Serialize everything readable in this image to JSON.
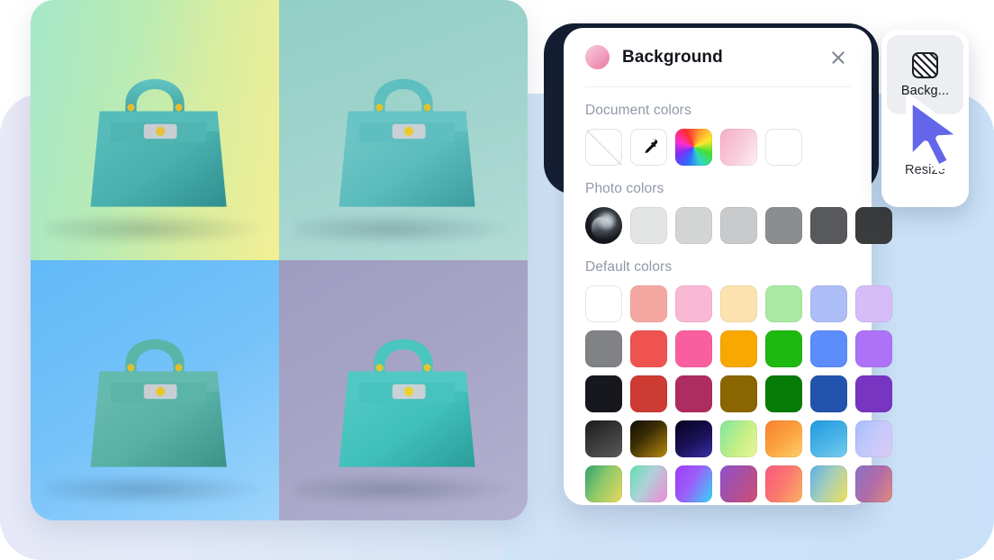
{
  "app": {
    "background_card_colors": [
      "#e8e8f6",
      "#cbe2f8"
    ]
  },
  "photo_grid": {
    "name": "handbag-variants-grid",
    "cells": [
      {
        "id": "q1",
        "background_label": "green to yellow gradient",
        "bg_from": "#a5e8c8",
        "bg_to": "#f2ef94",
        "bag_color": "#4fb8b5"
      },
      {
        "id": "q2",
        "background_label": "teal sage",
        "bg_from": "#92cfc7",
        "bg_to": "#b2dcd6",
        "bag_color": "#63c0c2"
      },
      {
        "id": "q3",
        "background_label": "sky blue",
        "bg_from": "#63b9f8",
        "bg_to": "#9dd4fb",
        "bag_color": "#5bb6ab"
      },
      {
        "id": "q4",
        "background_label": "muted lavender",
        "bg_from": "#9e9cc0",
        "bg_to": "#b3b1d0",
        "bag_color": "#4cc3c0"
      }
    ]
  },
  "panel": {
    "title": "Background",
    "title_swatch_color": "#ef8fb2",
    "close_label": "Close",
    "sections": [
      {
        "title": "Document colors",
        "swatches": [
          {
            "name": "no-color-swatch",
            "kind": "none",
            "label": "None"
          },
          {
            "name": "eyedropper-swatch",
            "kind": "eyedropper",
            "label": "Pick color"
          },
          {
            "name": "rainbow-swatch",
            "kind": "rainbow",
            "label": "Custom color"
          },
          {
            "name": "pink-gradient-swatch",
            "kind": "gradient",
            "color": "#f5adc6"
          },
          {
            "name": "white-swatch",
            "kind": "solid",
            "color": "#ffffff"
          }
        ]
      },
      {
        "title": "Photo colors",
        "swatches": [
          {
            "name": "photo-thumbnail-swatch",
            "kind": "photo",
            "label": "Source photo"
          },
          {
            "name": "gray-swatch-1",
            "kind": "solid",
            "color": "#e3e4e4"
          },
          {
            "name": "gray-swatch-2",
            "kind": "solid",
            "color": "#d3d4d4"
          },
          {
            "name": "gray-swatch-3",
            "kind": "solid",
            "color": "#c9cacb"
          },
          {
            "name": "gray-swatch-4",
            "kind": "solid",
            "color": "#8b8d8f"
          },
          {
            "name": "gray-swatch-5",
            "kind": "solid",
            "color": "#58595c"
          },
          {
            "name": "gray-swatch-6",
            "kind": "solid",
            "color": "#3a3b3d"
          }
        ]
      },
      {
        "title": "Default colors",
        "rows": [
          [
            {
              "name": "white",
              "color": "#ffffff",
              "bordered": true
            },
            {
              "name": "salmon",
              "color": "#f5a8a2"
            },
            {
              "name": "light-pink",
              "color": "#f9b8d4"
            },
            {
              "name": "cream",
              "color": "#fbe2ae"
            },
            {
              "name": "light-green",
              "color": "#a9e9a2"
            },
            {
              "name": "periwinkle",
              "color": "#adbdf6"
            },
            {
              "name": "light-purple",
              "color": "#d6bdf7"
            }
          ],
          [
            {
              "name": "gray",
              "color": "#808285"
            },
            {
              "name": "red",
              "color": "#ef5350"
            },
            {
              "name": "hot-pink",
              "color": "#f95f9f"
            },
            {
              "name": "amber",
              "color": "#f9a800"
            },
            {
              "name": "green",
              "color": "#1eb910"
            },
            {
              "name": "blue",
              "color": "#5d8cfb"
            },
            {
              "name": "violet",
              "color": "#ad72f7"
            }
          ],
          [
            {
              "name": "black",
              "color": "#16181d"
            },
            {
              "name": "brick-red",
              "color": "#cd3b32"
            },
            {
              "name": "magenta",
              "color": "#ae2d60"
            },
            {
              "name": "dark-gold",
              "color": "#8a6500"
            },
            {
              "name": "dark-green",
              "color": "#067c07"
            },
            {
              "name": "navy-blue",
              "color": "#2354ad"
            },
            {
              "name": "dark-violet",
              "color": "#7735c1"
            }
          ],
          [
            {
              "name": "gradient-charcoal",
              "gradient": "linear-gradient(150deg,#1b1b1b,#5a5a5a)"
            },
            {
              "name": "gradient-dark-gold",
              "gradient": "linear-gradient(140deg,#141008,#3a2d05 40%,#b8890b)"
            },
            {
              "name": "gradient-navy-indigo",
              "gradient": "linear-gradient(150deg,#05031f,#1b1258 55%,#3a2ea8)"
            },
            {
              "name": "gradient-green-yellow",
              "gradient": "linear-gradient(120deg,#7fe6a0,#c4ef85 55%,#ecf59a)"
            },
            {
              "name": "gradient-orange-yellow",
              "gradient": "linear-gradient(140deg,#f9802f,#fba23f 50%,#fdcf6a)"
            },
            {
              "name": "gradient-blue",
              "gradient": "linear-gradient(150deg,#1f9ae0,#4fb6e8 60%,#79cdee)"
            },
            {
              "name": "gradient-periwinkle-lavender",
              "gradient": "linear-gradient(120deg,#a8befb,#c4c9fb 50%,#ddc9f7)"
            }
          ],
          [
            {
              "name": "gradient-emerald-yellow",
              "gradient": "linear-gradient(120deg,#2fa16f,#8dc96a 45%,#e8d95e)"
            },
            {
              "name": "gradient-teal-pink",
              "gradient": "linear-gradient(120deg,#62e0b2,#aed1d8 45%,#f189d4)"
            },
            {
              "name": "gradient-purple-cyan",
              "gradient": "linear-gradient(120deg,#a03cf7,#9a5ff9 45%,#35d6f8)"
            },
            {
              "name": "gradient-purple-magenta",
              "gradient": "linear-gradient(120deg,#8e52c9,#ab4f9e 50%,#cf4f72)"
            },
            {
              "name": "gradient-pink-orange",
              "gradient": "linear-gradient(120deg,#f9577d,#fa7a6e 50%,#fcb264)"
            },
            {
              "name": "gradient-blue-yellow",
              "gradient": "linear-gradient(120deg,#5bb0e8,#a9cfb6 48%,#efe057)"
            },
            {
              "name": "gradient-violet-salmon",
              "gradient": "linear-gradient(120deg,#8a72c4,#b06ca8 50%,#e08b7d)"
            }
          ]
        ]
      }
    ]
  },
  "toolrail": {
    "tools": [
      {
        "name": "background",
        "label": "Backg...",
        "icon": "hatched-square-icon",
        "active": true
      },
      {
        "name": "resize",
        "label": "Resize",
        "icon": "resize-arrows-icon",
        "active": false
      }
    ]
  },
  "cursor": {
    "color": "#6366e8",
    "label": "pointer"
  }
}
